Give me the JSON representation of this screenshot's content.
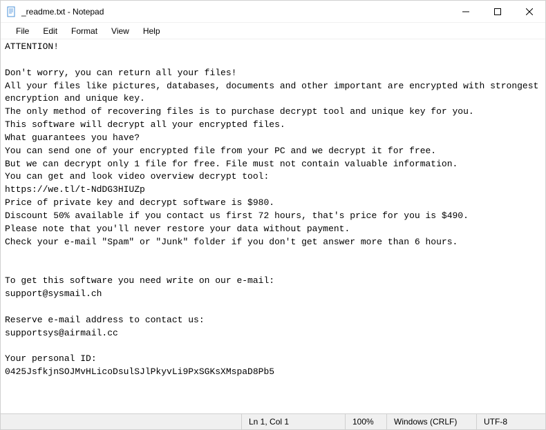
{
  "window": {
    "title": "_readme.txt - Notepad",
    "icon_name": "notepad-icon"
  },
  "menubar": {
    "items": [
      "File",
      "Edit",
      "Format",
      "View",
      "Help"
    ]
  },
  "document": {
    "text": "ATTENTION!\n\nDon't worry, you can return all your files!\nAll your files like pictures, databases, documents and other important are encrypted with strongest encryption and unique key.\nThe only method of recovering files is to purchase decrypt tool and unique key for you.\nThis software will decrypt all your encrypted files.\nWhat guarantees you have?\nYou can send one of your encrypted file from your PC and we decrypt it for free.\nBut we can decrypt only 1 file for free. File must not contain valuable information.\nYou can get and look video overview decrypt tool:\nhttps://we.tl/t-NdDG3HIUZp\nPrice of private key and decrypt software is $980.\nDiscount 50% available if you contact us first 72 hours, that's price for you is $490.\nPlease note that you'll never restore your data without payment.\nCheck your e-mail \"Spam\" or \"Junk\" folder if you don't get answer more than 6 hours.\n\n\nTo get this software you need write on our e-mail:\nsupport@sysmail.ch\n\nReserve e-mail address to contact us:\nsupportsys@airmail.cc\n\nYour personal ID:\n0425JsfkjnSOJMvHLicoDsulSJlPkyvLi9PxSGKsXMspaD8Pb5"
  },
  "statusbar": {
    "position": "Ln 1, Col 1",
    "zoom": "100%",
    "eol": "Windows (CRLF)",
    "encoding": "UTF-8"
  }
}
